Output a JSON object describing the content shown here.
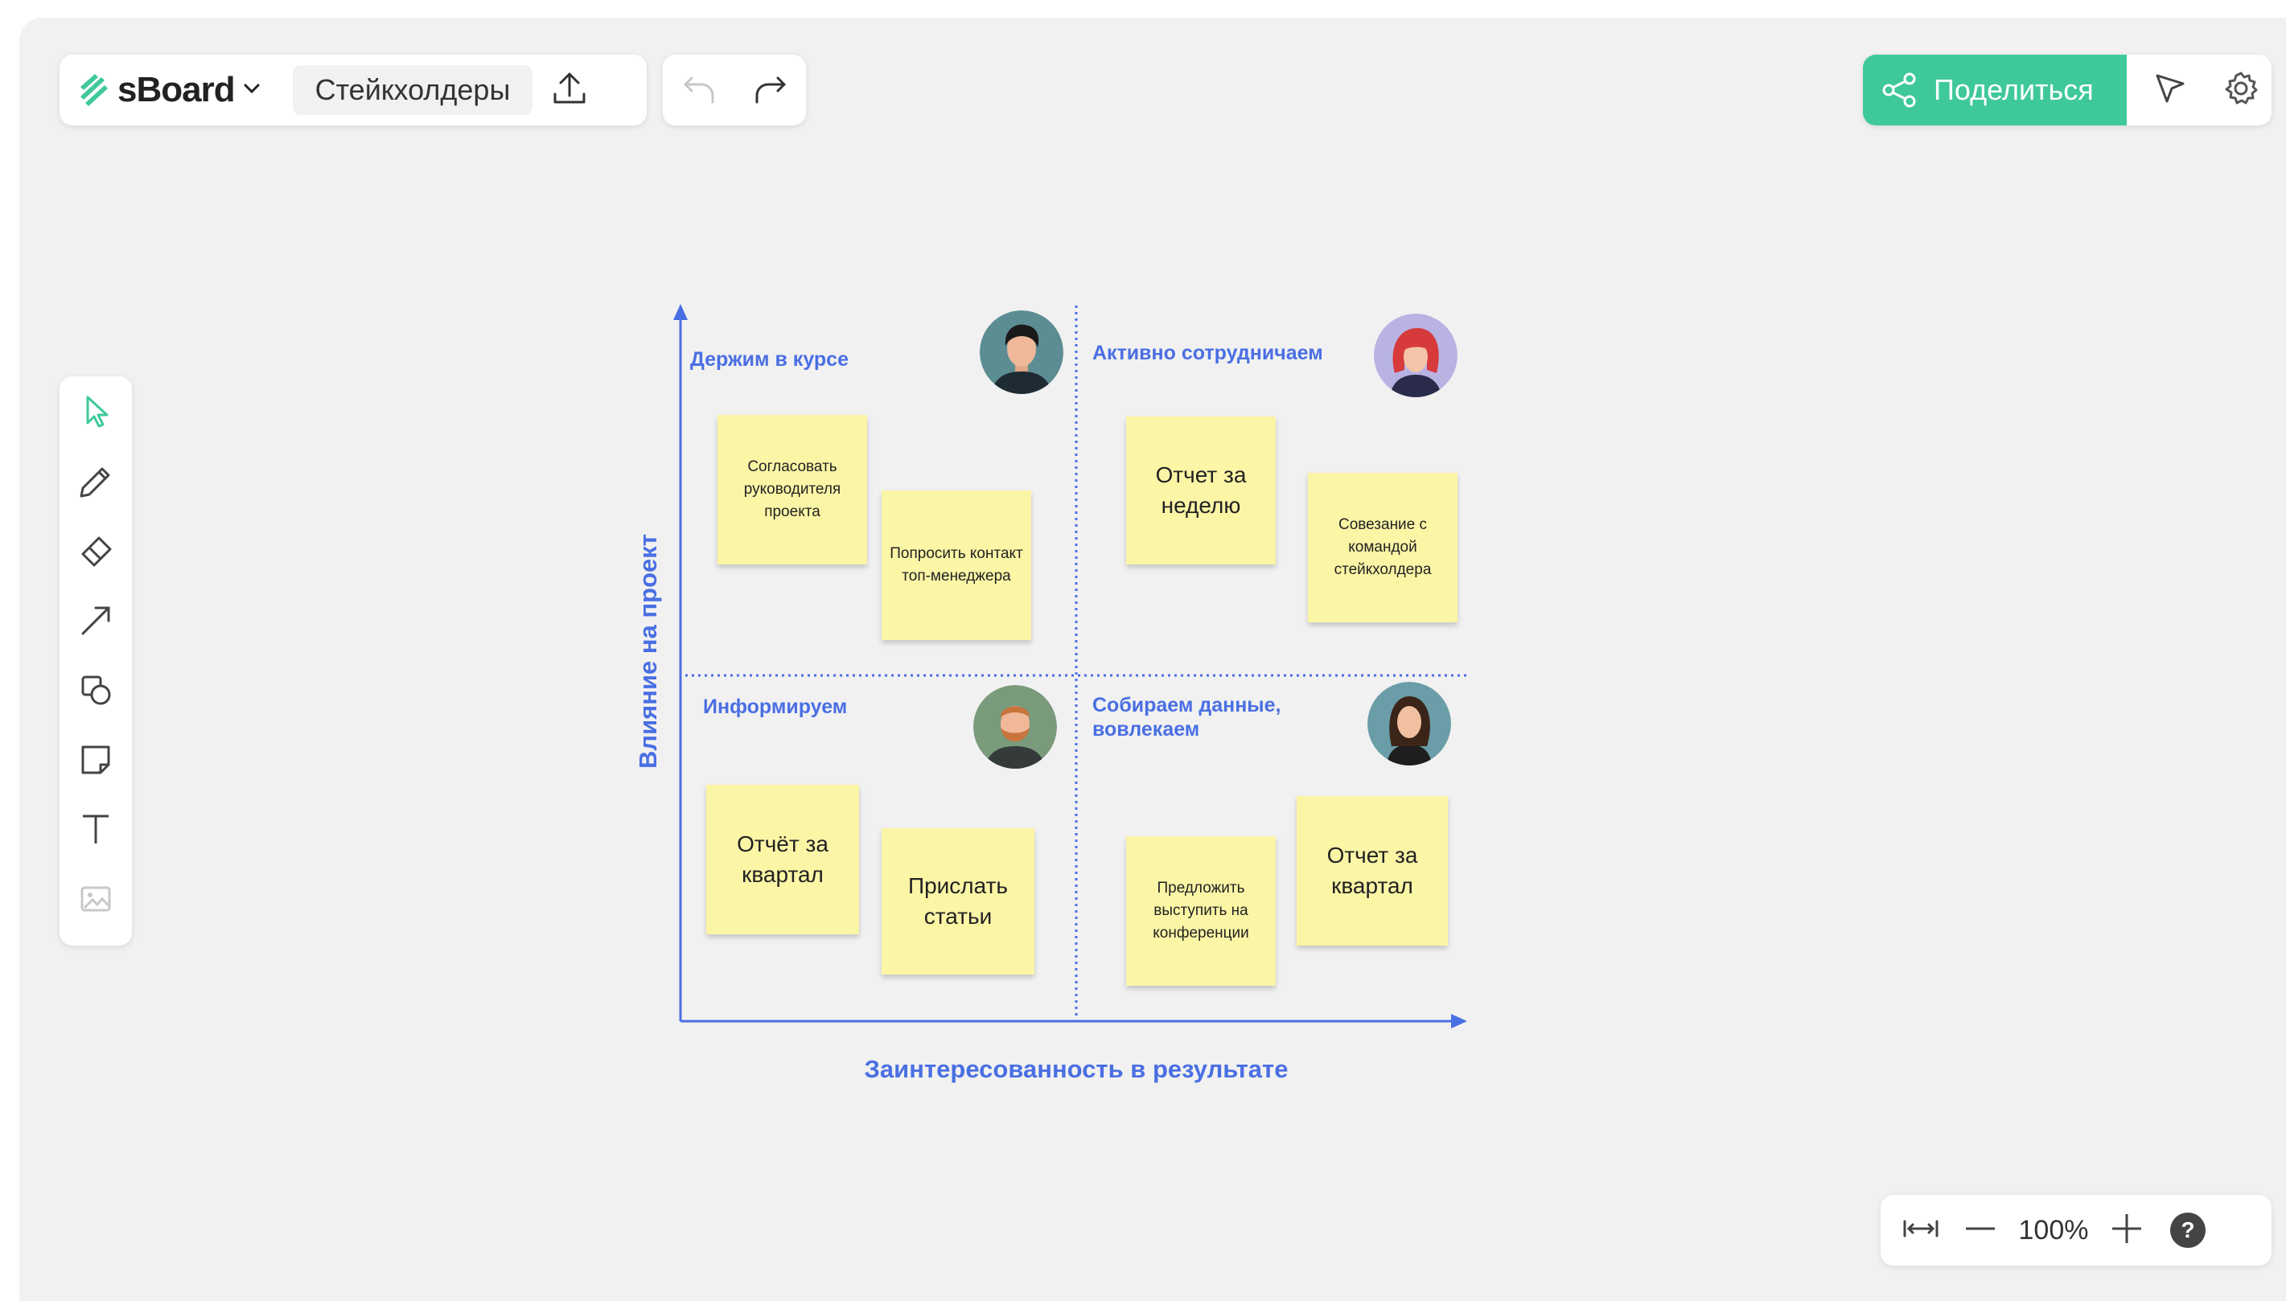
{
  "app": {
    "name": "sBoard",
    "board_name": "Стейкхолдеры"
  },
  "header": {
    "share_label": "Поделиться"
  },
  "zoom": {
    "level": "100%",
    "help": "?"
  },
  "colors": {
    "accent": "#3fc99a",
    "matrix_blue": "#4a6fe3",
    "note_yellow": "#fbf5a6",
    "canvas_bg": "#f1f1f1"
  },
  "toolbar": {
    "tools": [
      "cursor-icon",
      "pencil-icon",
      "eraser-icon",
      "arrow-line-icon",
      "shapes-icon",
      "sticky-note-icon",
      "text-icon",
      "image-icon"
    ]
  },
  "matrix": {
    "y_axis_label": "Влияние на проект",
    "x_axis_label": "Заинтересованность в результате",
    "quadrants": {
      "top_left": {
        "label": "Держим в курсе"
      },
      "top_right": {
        "label": "Активно сотрудничаем"
      },
      "bottom_left": {
        "label": "Информируем"
      },
      "bottom_right": {
        "label": "Собираем данные, вовлекаем"
      }
    },
    "notes": [
      {
        "text": "Согласовать руководителя проекта"
      },
      {
        "text": "Попросить контакт топ-менеджера"
      },
      {
        "text": "Отчет за неделю"
      },
      {
        "text": "Совезание с командой стейкхолдера"
      },
      {
        "text": "Отчёт за квартал"
      },
      {
        "text": "Прислать статьи"
      },
      {
        "text": "Предложить выступить на конференции"
      },
      {
        "text": "Отчет за квартал"
      }
    ]
  }
}
